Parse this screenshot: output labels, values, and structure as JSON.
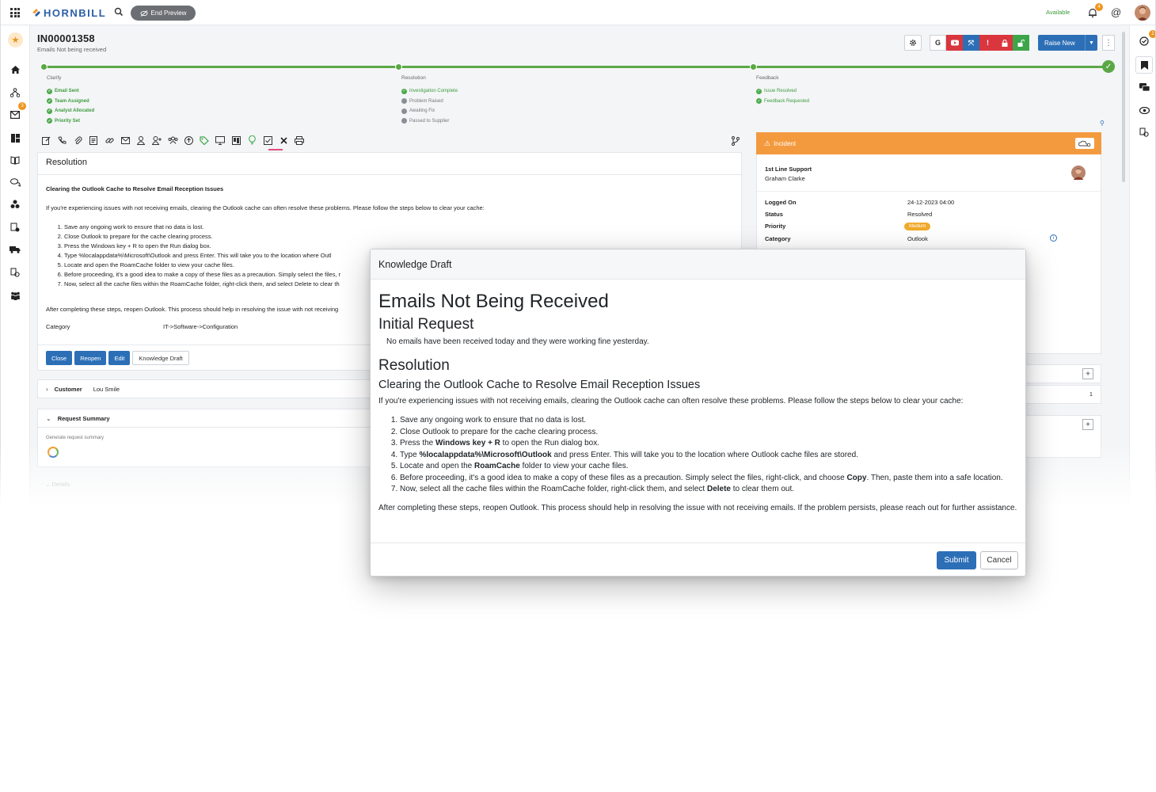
{
  "app": {
    "brand": "HORNBILL",
    "end_preview_label": "End Preview",
    "status": "Available",
    "notifications_count": "4",
    "at_symbol": "@"
  },
  "leftnav": {
    "mail_badge": "3"
  },
  "rightrail": {
    "tasks_badge": "2"
  },
  "record": {
    "id": "IN00001358",
    "summary": "Emails Not being received",
    "raise_new_label": "Raise New"
  },
  "stages": [
    {
      "title": "Clarify",
      "items": [
        {
          "label": "Email Sent",
          "state": "done"
        },
        {
          "label": "Team Assigned",
          "state": "done"
        },
        {
          "label": "Analyst Allocated",
          "state": "done"
        },
        {
          "label": "Priority Set",
          "state": "done"
        }
      ]
    },
    {
      "title": "Resolution",
      "items": [
        {
          "label": "Investigation Complete",
          "state": "done"
        },
        {
          "label": "Problem Raised",
          "state": "pending"
        },
        {
          "label": "Awaiting Fix",
          "state": "pending"
        },
        {
          "label": "Passed to Supplier",
          "state": "pending"
        }
      ]
    },
    {
      "title": "Feedback",
      "items": [
        {
          "label": "Issue Resolved",
          "state": "done"
        },
        {
          "label": "Feedback Requested",
          "state": "done"
        }
      ]
    }
  ],
  "resolution_panel": {
    "heading": "Resolution",
    "title": "Clearing the Outlook Cache to Resolve Email Reception Issues",
    "intro": "If you're experiencing issues with not receiving emails, clearing the Outlook cache can often resolve these problems. Please follow the steps below to clear your cache:",
    "steps": [
      "Save any ongoing work to ensure that no data is lost.",
      "Close Outlook to prepare for the cache clearing process.",
      "Press the Windows key + R to open the Run dialog box.",
      "Type %localappdata%\\Microsoft\\Outlook and press Enter. This will take you to the location where Outl",
      "Locate and open the RoamCache folder to view your cache files.",
      "Before proceeding, it's a good idea to make a copy of these files as a precaution. Simply select the files, r",
      "Now, select all the cache files within the RoamCache folder, right-click them, and select Delete to clear th"
    ],
    "after": "After completing these steps, reopen Outlook. This process should help in resolving the issue with not receiving",
    "category_label": "Category",
    "category_value": "IT->Software->Configuration",
    "buttons": {
      "close": "Close",
      "reopen": "Reopen",
      "edit": "Edit",
      "knowledge_draft": "Knowledge Draft"
    }
  },
  "customer_row": {
    "label": "Customer",
    "value": "Lou Smile"
  },
  "request_summary": {
    "label": "Request Summary",
    "generate": "Generate request summary"
  },
  "details_row": {
    "label": "Details"
  },
  "incident": {
    "header": "Incident",
    "team": "1st Line Support",
    "analyst": "Graham Clarke",
    "fields": [
      {
        "label": "Logged On",
        "value": "24-12-2023 04:00"
      },
      {
        "label": "Status",
        "value": "Resolved"
      },
      {
        "label": "Priority",
        "value": "Medium"
      },
      {
        "label": "Category",
        "value": "Outlook"
      }
    ],
    "count": "1"
  },
  "modal": {
    "title": "Knowledge Draft",
    "h1": "Emails Not Being Received",
    "initial_request_heading": "Initial Request",
    "initial_request_text": "No emails have been received today and they were working fine yesterday.",
    "resolution_heading": "Resolution",
    "resolution_title": "Clearing the Outlook Cache to Resolve Email Reception Issues",
    "intro": "If you're experiencing issues with not receiving emails, clearing the Outlook cache can often resolve these problems. Please follow the steps below to clear your cache:",
    "steps": [
      {
        "before": "Save any ongoing work to ensure that no data is lost.",
        "bold": "",
        "after": ""
      },
      {
        "before": "Close Outlook to prepare for the cache clearing process.",
        "bold": "",
        "after": ""
      },
      {
        "before": "Press the ",
        "bold": "Windows key + R",
        "after": " to open the Run dialog box."
      },
      {
        "before": "Type ",
        "bold": "%localappdata%\\Microsoft\\Outlook",
        "after": " and press Enter. This will take you to the location where Outlook cache files are stored."
      },
      {
        "before": "Locate and open the ",
        "bold": "RoamCache",
        "after": " folder to view your cache files."
      },
      {
        "before": "Before proceeding, it's a good idea to make a copy of these files as a precaution. Simply select the files, right-click, and choose ",
        "bold": "Copy",
        "after": ". Then, paste them into a safe location."
      },
      {
        "before": "Now, select all the cache files within the RoamCache folder, right-click them, and select ",
        "bold": "Delete",
        "after": " to clear them out."
      }
    ],
    "after": "After completing these steps, reopen Outlook. This process should help in resolving the issue with not receiving emails. If the problem persists, please reach out for further assistance.",
    "submit_label": "Submit",
    "cancel_label": "Cancel"
  }
}
